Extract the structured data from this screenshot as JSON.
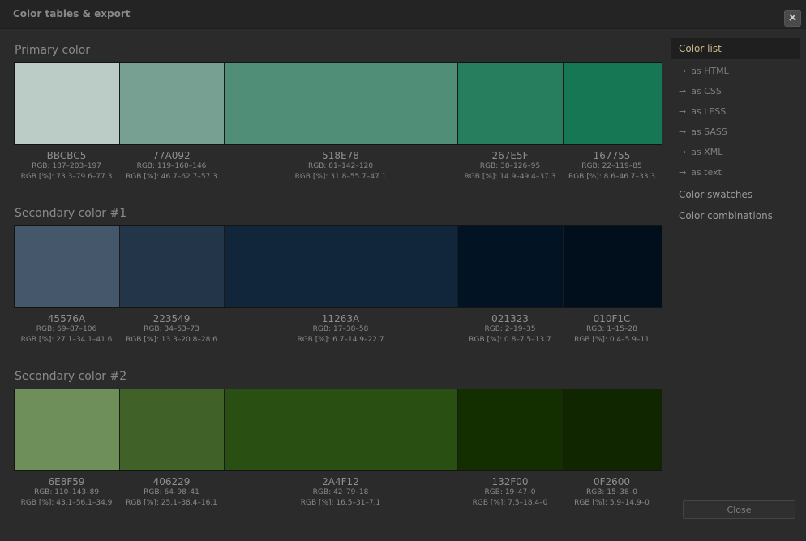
{
  "window": {
    "title": "Color tables & export",
    "close_icon": "×"
  },
  "sections": [
    {
      "title": "Primary color",
      "swatches": [
        {
          "hex": "BBCBC5",
          "color": "#BBCBC5",
          "rgb": "RGB: 187–203–197",
          "pct": "RGB [%]: 73.3–79.6–77.3"
        },
        {
          "hex": "77A092",
          "color": "#77A092",
          "rgb": "RGB: 119–160–146",
          "pct": "RGB [%]: 46.7–62.7–57.3"
        },
        {
          "hex": "518E78",
          "color": "#518E78",
          "rgb": "RGB: 81–142–120",
          "pct": "RGB [%]: 31.8–55.7–47.1"
        },
        {
          "hex": "267E5F",
          "color": "#267E5F",
          "rgb": "RGB: 38–126–95",
          "pct": "RGB [%]: 14.9–49.4–37.3"
        },
        {
          "hex": "167755",
          "color": "#167755",
          "rgb": "RGB: 22–119–85",
          "pct": "RGB [%]: 8.6–46.7–33.3"
        }
      ]
    },
    {
      "title": "Secondary color #1",
      "swatches": [
        {
          "hex": "45576A",
          "color": "#45576A",
          "rgb": "RGB: 69–87–106",
          "pct": "RGB [%]: 27.1–34.1–41.6"
        },
        {
          "hex": "223549",
          "color": "#223549",
          "rgb": "RGB: 34–53–73",
          "pct": "RGB [%]: 13.3–20.8–28.6"
        },
        {
          "hex": "11263A",
          "color": "#11263A",
          "rgb": "RGB: 17–38–58",
          "pct": "RGB [%]: 6.7–14.9–22.7"
        },
        {
          "hex": "021323",
          "color": "#021323",
          "rgb": "RGB: 2–19–35",
          "pct": "RGB [%]: 0.8–7.5–13.7"
        },
        {
          "hex": "010F1C",
          "color": "#010F1C",
          "rgb": "RGB: 1–15–28",
          "pct": "RGB [%]: 0.4–5.9–11"
        }
      ]
    },
    {
      "title": "Secondary color #2",
      "swatches": [
        {
          "hex": "6E8F59",
          "color": "#6E8F59",
          "rgb": "RGB: 110–143–89",
          "pct": "RGB [%]: 43.1–56.1–34.9"
        },
        {
          "hex": "406229",
          "color": "#406229",
          "rgb": "RGB: 64–98–41",
          "pct": "RGB [%]: 25.1–38.4–16.1"
        },
        {
          "hex": "2A4F12",
          "color": "#2A4F12",
          "rgb": "RGB: 42–79–18",
          "pct": "RGB [%]: 16.5–31–7.1"
        },
        {
          "hex": "132F00",
          "color": "#132F00",
          "rgb": "RGB: 19–47–0",
          "pct": "RGB [%]: 7.5–18.4–0"
        },
        {
          "hex": "0F2600",
          "color": "#0F2600",
          "rgb": "RGB: 15–38–0",
          "pct": "RGB [%]: 5.9–14.9–0"
        }
      ]
    }
  ],
  "sidebar": {
    "active": "Color list",
    "arrow": "→",
    "sub_items": [
      "as HTML",
      "as CSS",
      "as LESS",
      "as SASS",
      "as XML",
      "as text"
    ],
    "swatches": "Color swatches",
    "combinations": "Color combinations"
  },
  "footer": {
    "close_label": "Close"
  }
}
